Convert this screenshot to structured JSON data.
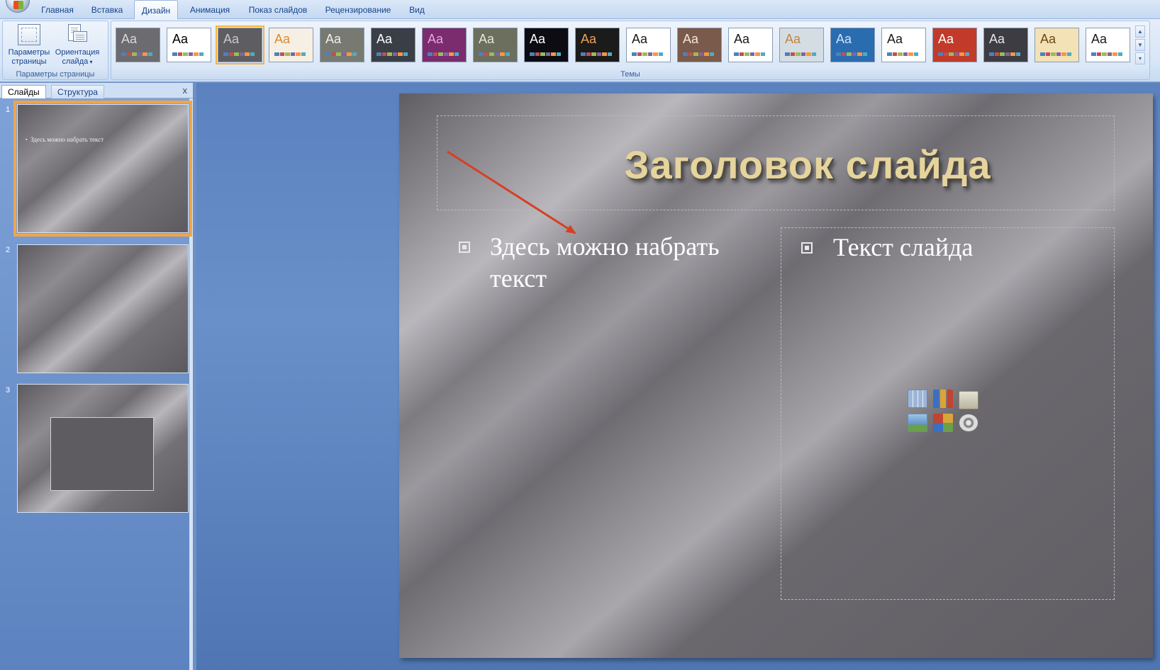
{
  "ribbon_tabs": [
    "Главная",
    "Вставка",
    "Дизайн",
    "Анимация",
    "Показ слайдов",
    "Рецензирование",
    "Вид"
  ],
  "active_tab": "Дизайн",
  "page_setup_group": {
    "label": "Параметры страницы",
    "buttons": {
      "page_setup": "Параметры страницы",
      "orientation": "Ориентация слайда"
    }
  },
  "themes_group": {
    "label": "Темы",
    "theme_sample_text": "Aa",
    "themes": [
      {
        "name": "theme-1",
        "bg": "#6b6b70",
        "fg": "#d9d9d9",
        "selected": false
      },
      {
        "name": "theme-2",
        "bg": "#ffffff",
        "fg": "#000000",
        "selected": false
      },
      {
        "name": "theme-3",
        "bg": "#5e5d61",
        "fg": "#c9c9c9",
        "selected": true
      },
      {
        "name": "theme-4",
        "bg": "#f6f0e4",
        "fg": "#d98a2e",
        "selected": false
      },
      {
        "name": "theme-5",
        "bg": "#787a72",
        "fg": "#f0f0f0",
        "selected": false
      },
      {
        "name": "theme-6",
        "bg": "#3a3e46",
        "fg": "#ffffff",
        "selected": false
      },
      {
        "name": "theme-7",
        "bg": "#7a2c6e",
        "fg": "#e6a6df",
        "selected": false
      },
      {
        "name": "theme-8",
        "bg": "#6c6e5e",
        "fg": "#e6e6d9",
        "selected": false
      },
      {
        "name": "theme-9",
        "bg": "#0c0c12",
        "fg": "#ffffff",
        "selected": false
      },
      {
        "name": "theme-10",
        "bg": "#1b1b1b",
        "fg": "#f0a15a",
        "selected": false
      },
      {
        "name": "theme-11",
        "bg": "#ffffff",
        "fg": "#1a1a1a",
        "selected": false
      },
      {
        "name": "theme-12",
        "bg": "#7a5a4a",
        "fg": "#f6e6d8",
        "selected": false
      },
      {
        "name": "theme-13",
        "bg": "#ffffff",
        "fg": "#1a1a1a",
        "selected": false
      },
      {
        "name": "theme-14",
        "bg": "#d4dde3",
        "fg": "#c9833c",
        "selected": false
      },
      {
        "name": "theme-15",
        "bg": "#2a6cb0",
        "fg": "#cfe3f7",
        "selected": false
      },
      {
        "name": "theme-16",
        "bg": "#ffffff",
        "fg": "#1a1a1a",
        "selected": false
      },
      {
        "name": "theme-17",
        "bg": "#c23a2a",
        "fg": "#ffffff",
        "selected": false
      },
      {
        "name": "theme-18",
        "bg": "#3c3c42",
        "fg": "#e6e6e6",
        "selected": false
      },
      {
        "name": "theme-19",
        "bg": "#f3e2b6",
        "fg": "#6a4a12",
        "selected": false
      },
      {
        "name": "theme-20",
        "bg": "#ffffff",
        "fg": "#1a1a1a",
        "selected": false
      }
    ]
  },
  "slides_panel": {
    "tabs": [
      "Слайды",
      "Структура"
    ],
    "active": "Слайды",
    "close": "x",
    "slides": [
      {
        "number": "1",
        "text": "Здесь можно набрать текст",
        "selected": true
      },
      {
        "number": "2",
        "text": "",
        "selected": false
      },
      {
        "number": "3",
        "text": "",
        "selected": false
      }
    ]
  },
  "slide": {
    "title": "Заголовок слайда",
    "left_bullet": "Здесь можно набрать текст",
    "right_bullet": "Текст слайда",
    "title_color": "#e6d49d",
    "arrow_color": "#d64024"
  }
}
